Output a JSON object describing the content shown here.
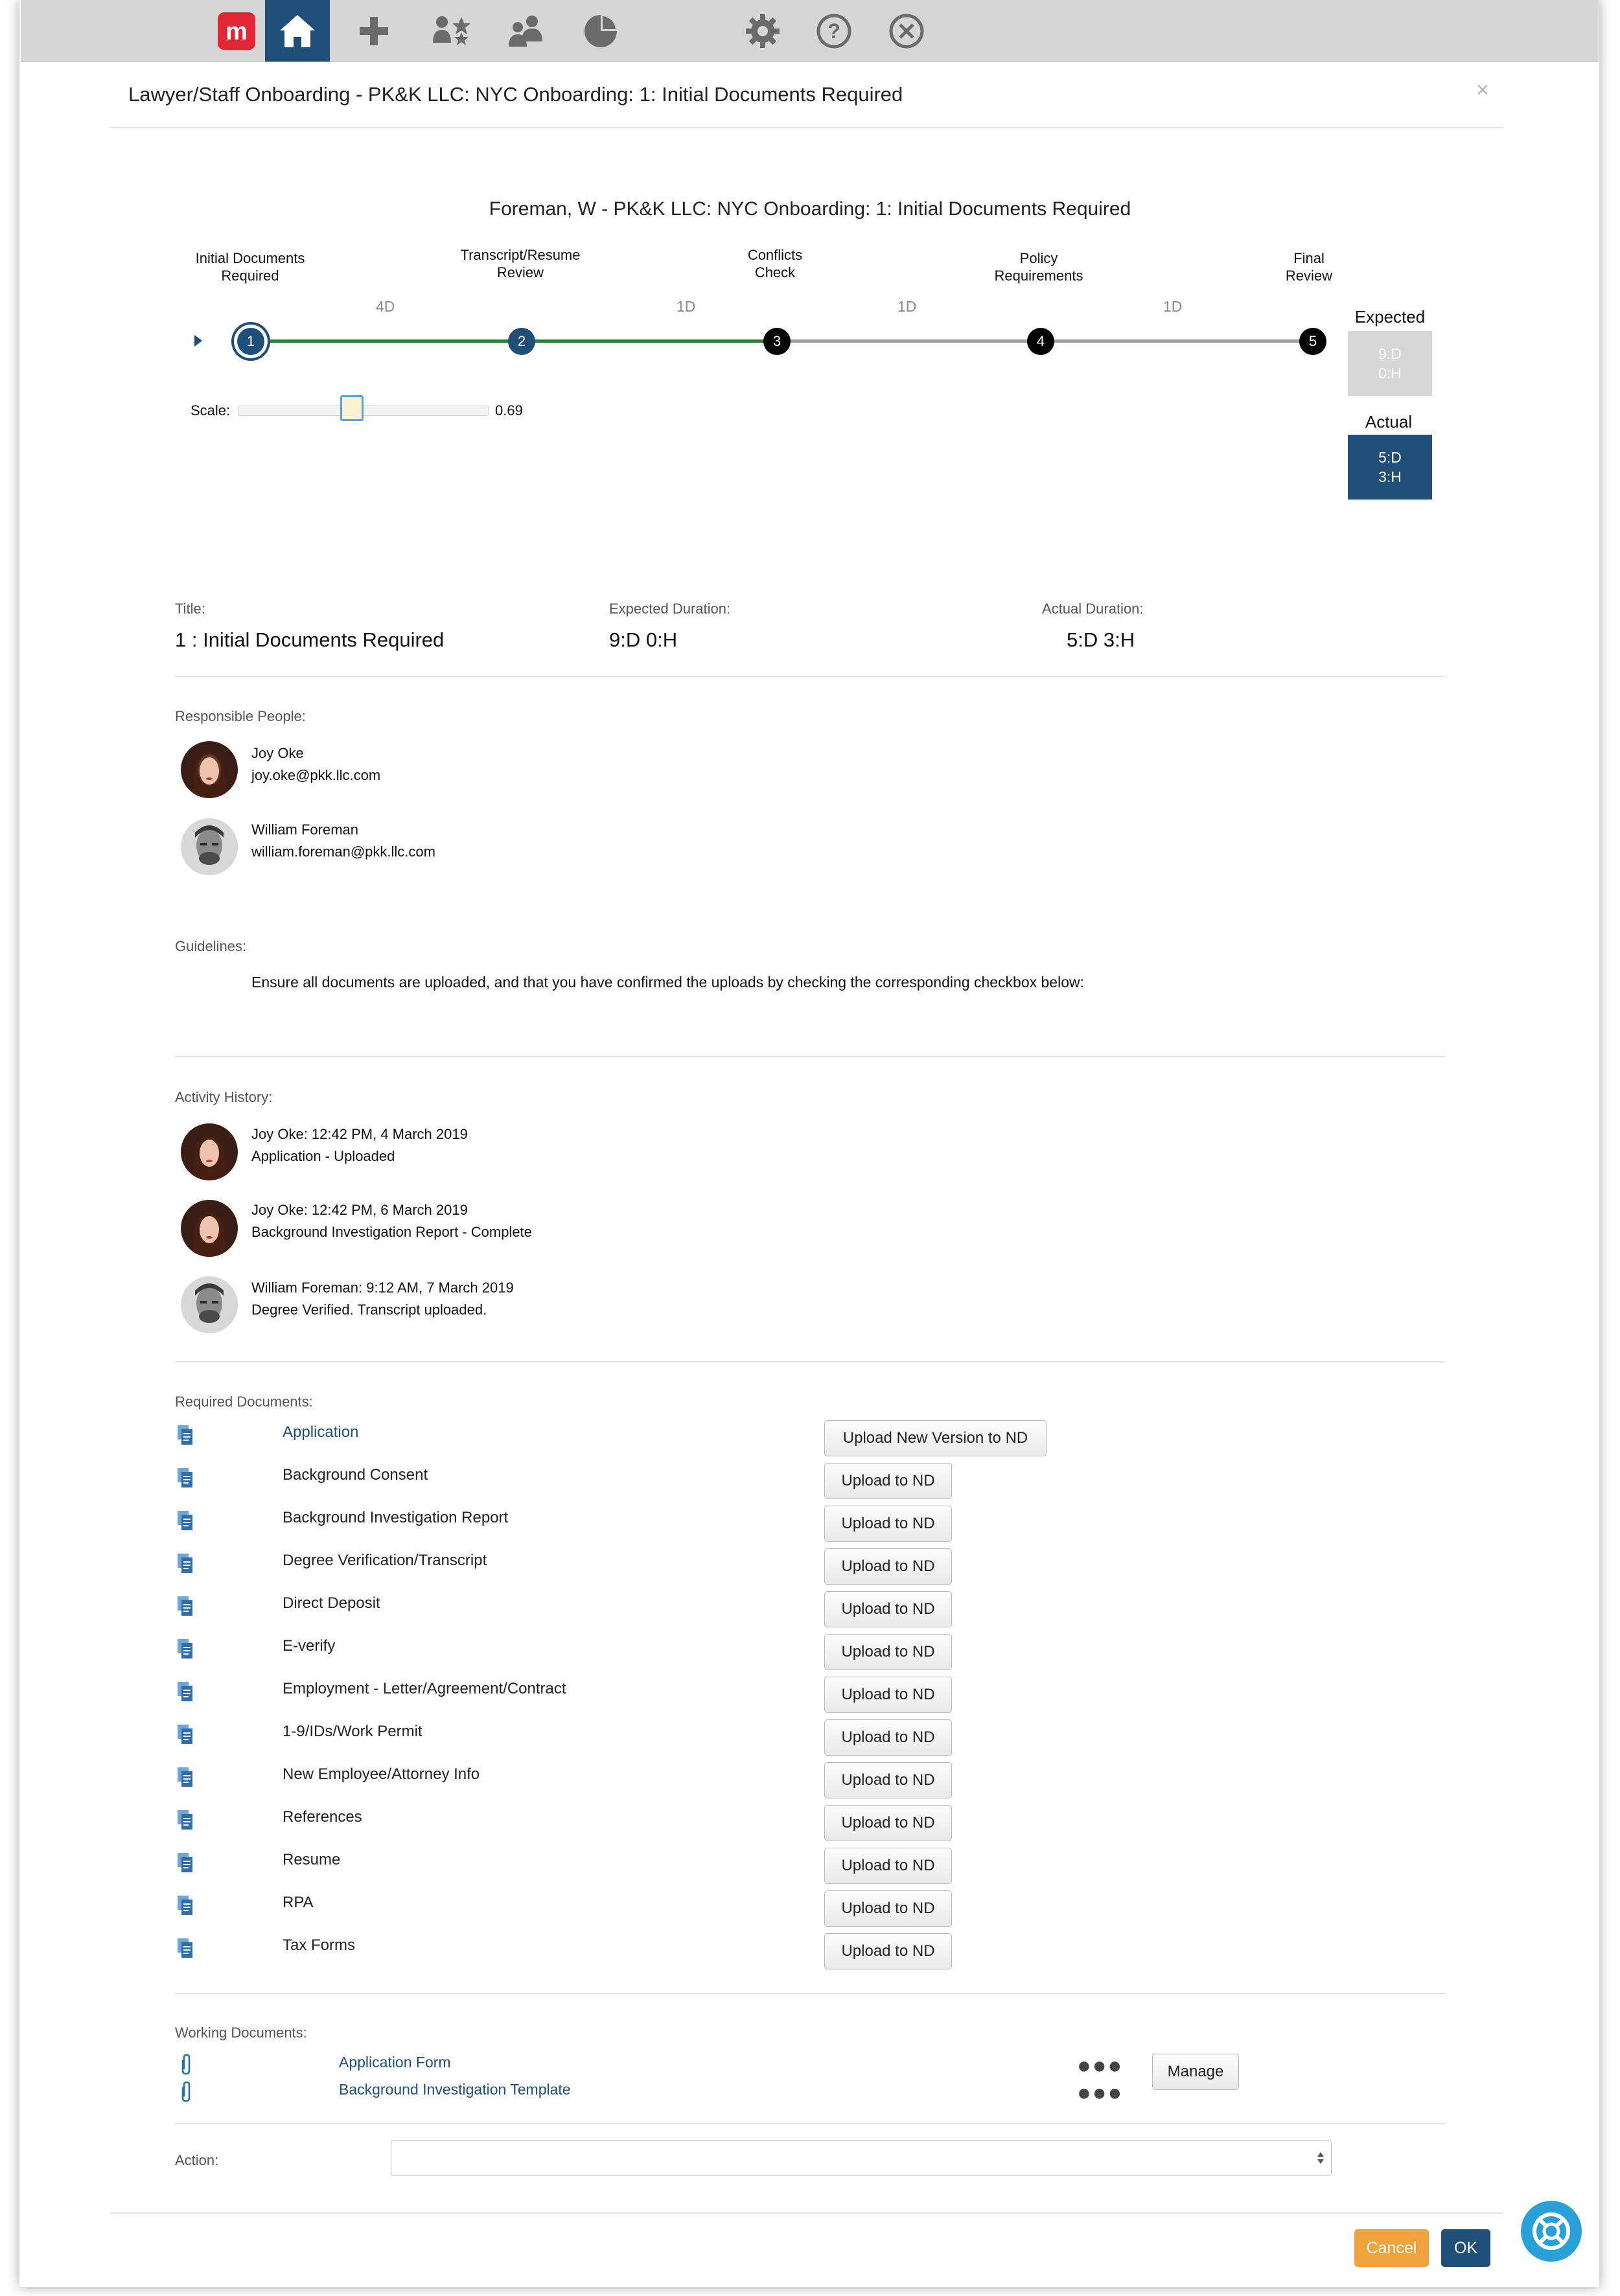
{
  "topbar": {
    "icons": [
      "app-logo-icon",
      "home-icon",
      "plus-icon",
      "starred-people-icon",
      "people-icon",
      "pie-chart-icon",
      "gear-icon",
      "help-icon",
      "close-circle-icon"
    ],
    "logo_letter": "m",
    "accent": "#1f4e79",
    "logo_color": "#e32636"
  },
  "modal": {
    "title": "Lawyer/Staff Onboarding - PK&K LLC: NYC Onboarding: 1: Initial Documents Required",
    "close": "×"
  },
  "workflow": {
    "title": "Foreman, W - PK&K LLC: NYC Onboarding: 1: Initial Documents Required",
    "steps": [
      {
        "number": "1",
        "label_line1": "Initial Documents",
        "label_line2": "Required"
      },
      {
        "number": "2",
        "label_line1": "Transcript/Resume",
        "label_line2": "Review"
      },
      {
        "number": "3",
        "label_line1": "Conflicts",
        "label_line2": "Check"
      },
      {
        "number": "4",
        "label_line1": "Policy",
        "label_line2": "Requirements"
      },
      {
        "number": "5",
        "label_line1": "Final",
        "label_line2": "Review"
      }
    ],
    "durations": [
      "4D",
      "1D",
      "1D",
      "1D"
    ],
    "scale_label": "Scale:",
    "scale_value": "0.69",
    "scale_fraction": 0.45,
    "expected_title": "Expected",
    "expected_line1": "9:D",
    "expected_line2": "0:H",
    "actual_title": "Actual",
    "actual_line1": "5:D",
    "actual_line2": "3:H"
  },
  "details": {
    "title_label": "Title:",
    "title_value": "1 : Initial Documents Required",
    "expected_label": "Expected Duration:",
    "expected_value": "9:D 0:H",
    "actual_label": "Actual Duration:",
    "actual_value": "5:D 3:H"
  },
  "responsible": {
    "label": "Responsible People:",
    "people": [
      {
        "name": "Joy  Oke",
        "email": "joy.oke@pkk.llc.com"
      },
      {
        "name": "William Foreman",
        "email": "william.foreman@pkk.llc.com"
      }
    ]
  },
  "guidelines": {
    "label": "Guidelines:",
    "text": "Ensure all documents are uploaded, and that you have confirmed the uploads by checking the corresponding checkbox below:"
  },
  "activity": {
    "label": "Activity History:",
    "items": [
      {
        "line1": "Joy  Oke: 12:42 PM, 4 March 2019",
        "line2": "Application - Uploaded"
      },
      {
        "line1": "Joy  Oke: 12:42 PM, 6 March 2019",
        "line2": "Background Investigation Report - Complete"
      },
      {
        "line1": "William Foreman: 9:12 AM, 7 March 2019",
        "line2": "Degree Verified. Transcript uploaded."
      }
    ]
  },
  "required_docs": {
    "label": "Required Documents:",
    "items": [
      {
        "name": "Application",
        "button": "Upload New Version to ND"
      },
      {
        "name": "Background Consent",
        "button": "Upload to ND"
      },
      {
        "name": "Background Investigation Report",
        "button": "Upload to ND"
      },
      {
        "name": "Degree Verification/Transcript",
        "button": "Upload to ND"
      },
      {
        "name": "Direct Deposit",
        "button": "Upload to ND"
      },
      {
        "name": "E-verify",
        "button": "Upload to ND"
      },
      {
        "name": "Employment - Letter/Agreement/Contract",
        "button": "Upload to ND"
      },
      {
        "name": "1-9/IDs/Work Permit",
        "button": "Upload to ND"
      },
      {
        "name": "New Employee/Attorney Info",
        "button": "Upload to ND"
      },
      {
        "name": "References",
        "button": "Upload to ND"
      },
      {
        "name": "Resume",
        "button": "Upload to ND"
      },
      {
        "name": "RPA",
        "button": "Upload to ND"
      },
      {
        "name": "Tax Forms",
        "button": "Upload to ND"
      }
    ]
  },
  "working_docs": {
    "label": "Working Documents:",
    "items": [
      {
        "name": "Application Form"
      },
      {
        "name": "Background Investigation Template"
      }
    ],
    "manage_label": "Manage"
  },
  "action": {
    "label": "Action:",
    "value": ""
  },
  "footer": {
    "cancel_label": "Cancel",
    "ok_label": "OK"
  }
}
